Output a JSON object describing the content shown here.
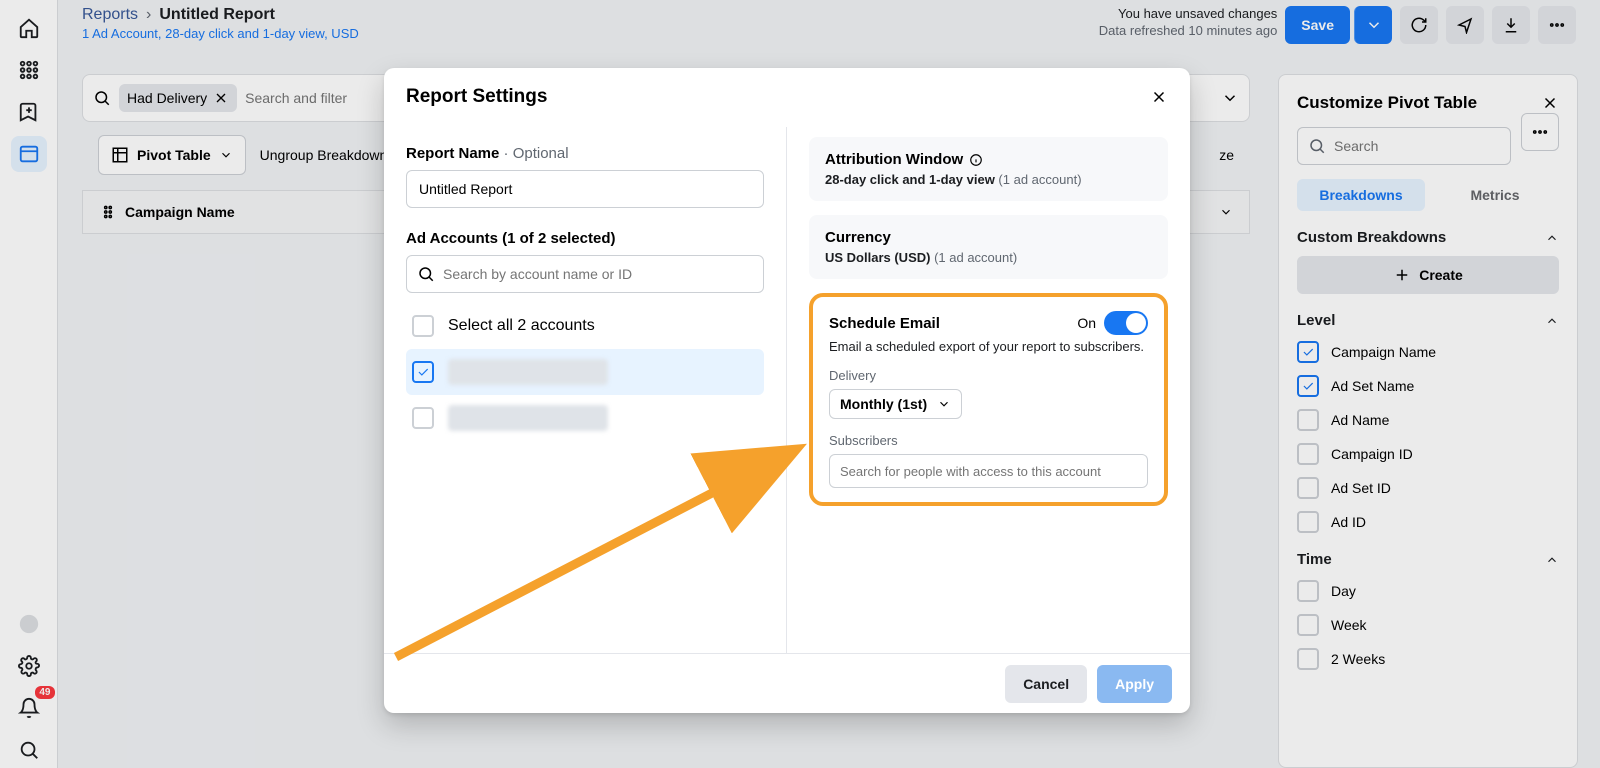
{
  "rail": {
    "badge": "49"
  },
  "header": {
    "breadcrumb_root": "Reports",
    "breadcrumb_current": "Untitled Report",
    "subline": "1 Ad Account, 28-day click and 1-day view, USD",
    "unsaved": "You have unsaved changes",
    "refreshed": "Data refreshed 10 minutes ago",
    "save": "Save"
  },
  "filter": {
    "chip": "Had Delivery",
    "placeholder": "Search and filter"
  },
  "toolbar": {
    "pivot": "Pivot Table",
    "ungroup": "Ungroup Breakdowns",
    "customize_tail": "ze"
  },
  "table": {
    "col1": "Campaign Name"
  },
  "panel": {
    "title": "Customize Pivot Table",
    "search_ph": "Search",
    "tabs": {
      "breakdowns": "Breakdowns",
      "metrics": "Metrics"
    },
    "custom_h": "Custom Breakdowns",
    "create": "Create",
    "level_h": "Level",
    "level": [
      "Campaign Name",
      "Ad Set Name",
      "Ad Name",
      "Campaign ID",
      "Ad Set ID",
      "Ad ID"
    ],
    "time_h": "Time",
    "time": [
      "Day",
      "Week",
      "2 Weeks"
    ]
  },
  "modal": {
    "title": "Report Settings",
    "name_lbl": "Report Name",
    "optional": " · Optional",
    "name_val": "Untitled Report",
    "accts_lbl": "Ad Accounts (1 of 2 selected)",
    "accts_search": "Search by account name or ID",
    "select_all": "Select all 2 accounts",
    "attr_h": "Attribution Window",
    "attr_sub_b": "28-day click and 1-day view",
    "attr_sub_m": " (1 ad account)",
    "curr_h": "Currency",
    "curr_sub_b": "US Dollars (USD)",
    "curr_sub_m": " (1 ad account)",
    "sched_h": "Schedule Email",
    "sched_on": "On",
    "sched_desc": "Email a scheduled export of your report to subscribers.",
    "delivery_lbl": "Delivery",
    "delivery_val": "Monthly (1st)",
    "subs_lbl": "Subscribers",
    "subs_ph": "Search for people with access to this account",
    "cancel": "Cancel",
    "apply": "Apply"
  }
}
